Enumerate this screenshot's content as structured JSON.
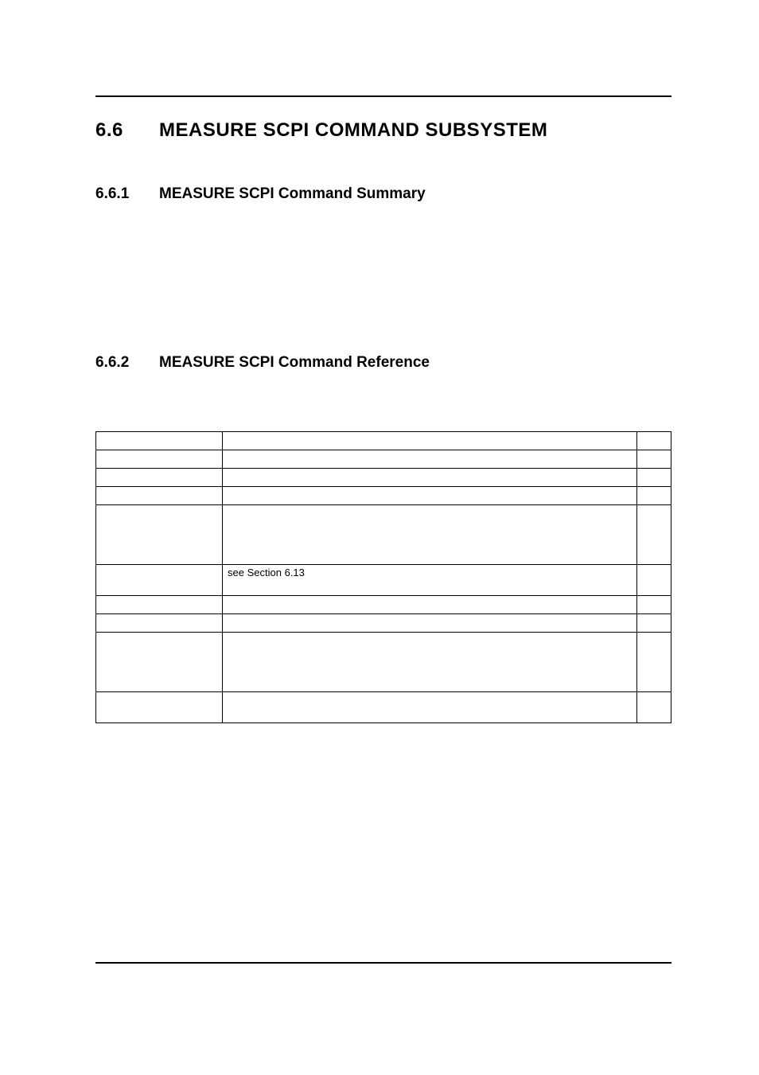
{
  "heading1": {
    "number": "6.6",
    "title": "MEASURE SCPI COMMAND SUBSYSTEM"
  },
  "heading2a": {
    "number": "6.6.1",
    "title": "MEASURE SCPI Command Summary"
  },
  "heading2b": {
    "number": "6.6.2",
    "title": "MEASURE SCPI Command Reference"
  },
  "table": {
    "rows": [
      {
        "c1": "",
        "c2": "",
        "c3": "",
        "class": ""
      },
      {
        "c1": "",
        "c2": "",
        "c3": "",
        "class": ""
      },
      {
        "c1": "",
        "c2": "",
        "c3": "",
        "class": ""
      },
      {
        "c1": "",
        "c2": "",
        "c3": "",
        "class": ""
      },
      {
        "c1": "",
        "c2": "",
        "c3": "",
        "class": "tall"
      },
      {
        "c1": "",
        "c2": "see Section 6.13",
        "c3": "",
        "class": "short-tall"
      },
      {
        "c1": "",
        "c2": "",
        "c3": "",
        "class": ""
      },
      {
        "c1": "",
        "c2": "",
        "c3": "",
        "class": ""
      },
      {
        "c1": "",
        "c2": "",
        "c3": "",
        "class": "tall"
      },
      {
        "c1": "",
        "c2": "",
        "c3": "",
        "class": "short-tall"
      }
    ]
  }
}
